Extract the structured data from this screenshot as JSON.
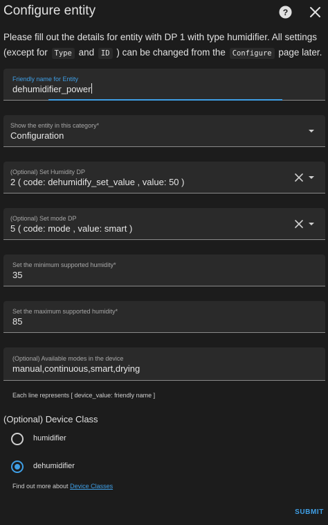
{
  "dialog": {
    "title": "Configure entity"
  },
  "description": {
    "part1": "Please fill out the details for entity with DP 1 with type humidifier. All settings (except for",
    "code1": "Type",
    "part2": "and",
    "code2": "ID",
    "part3": ") can be changed from the",
    "code3": "Configure",
    "part4": "page later."
  },
  "fields": {
    "friendly_name": {
      "label": "Friendly name for Entity",
      "value": "dehumidifier_power"
    },
    "category": {
      "label": "Show the entity in this category*",
      "value": "Configuration"
    },
    "humidity_dp": {
      "label": "(Optional) Set Humidity DP",
      "value": "2 ( code: dehumidify_set_value , value: 50 )"
    },
    "mode_dp": {
      "label": "(Optional) Set mode DP",
      "value": "5 ( code: mode , value: smart )"
    },
    "min_humidity": {
      "label": "Set the minimum supported humidity*",
      "value": "35"
    },
    "max_humidity": {
      "label": "Set the maximum supported humidity*",
      "value": "85"
    },
    "modes": {
      "label": "(Optional) Available modes in the device",
      "value": "manual,continuous,smart,drying"
    }
  },
  "modes_helper": "Each line represents [ device_value: friendly name ]",
  "device_class": {
    "title": "(Optional) Device Class",
    "options": [
      {
        "label": "humidifier",
        "selected": false
      },
      {
        "label": "dehumidifier",
        "selected": true
      }
    ],
    "more_text": "Find out more about",
    "more_link": "Device Classes"
  },
  "actions": {
    "submit_label": "SUBMIT"
  },
  "colors": {
    "accent": "#3f9fe6",
    "background": "#1c1c1c",
    "field_background": "#2a2a2a"
  }
}
